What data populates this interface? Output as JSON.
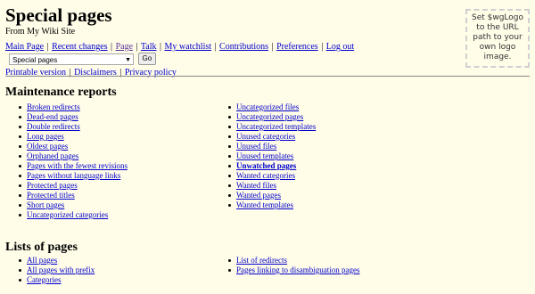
{
  "site": {
    "title": "Special pages",
    "subtitle": "From My Wiki Site",
    "logo_text": "Set $wgLogo to the URL path to your own logo image."
  },
  "nav": {
    "row1": [
      "Main Page",
      "Recent changes",
      "Page",
      "Talk",
      "My watchlist",
      "Contributions",
      "Preferences",
      "Log out"
    ],
    "select_value": "Special pages",
    "go_label": "Go",
    "row2": [
      "Printable version",
      "Disclaimers",
      "Privacy policy"
    ]
  },
  "maintenance": {
    "heading": "Maintenance reports",
    "col1": [
      "Broken redirects",
      "Dead-end pages",
      "Double redirects",
      "Long pages",
      "Oldest pages",
      "Orphaned pages",
      "Pages with the fewest revisions",
      "Pages without language links",
      "Protected pages",
      "Protected titles",
      "Short pages",
      "Uncategorized categories"
    ],
    "col2": [
      "Uncategorized files",
      "Uncategorized pages",
      "Uncategorized templates",
      "Unused categories",
      "Unused files",
      "Unused templates",
      "Unwatched pages",
      "Wanted categories",
      "Wanted files",
      "Wanted pages",
      "Wanted templates"
    ]
  },
  "lists": {
    "heading": "Lists of pages",
    "col1": [
      "All pages",
      "All pages with prefix",
      "Categories"
    ],
    "col2": [
      "List of redirects",
      "Pages linking to disambiguation pages"
    ]
  },
  "colors": {
    "background": "#fffce8",
    "link": "#0000cc",
    "visited": "#5a3696"
  }
}
